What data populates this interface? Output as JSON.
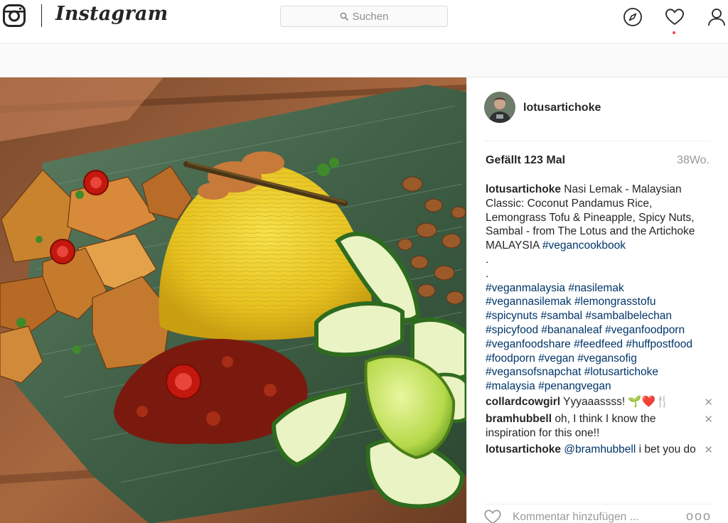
{
  "nav": {
    "logo_wordmark": "Instagram",
    "search_placeholder": "Suchen",
    "icons": [
      "instagram-glyph-icon",
      "compass-icon",
      "heart-icon",
      "profile-icon"
    ],
    "notification_dot_color": "#ed4956"
  },
  "post": {
    "author": "lotusartichoke",
    "likes": "Gefällt 123 Mal",
    "age": "38Wo.",
    "caption": {
      "username": "lotusartichoke",
      "text": "Nasi Lemak - Malaysian Classic: Coconut Pandamus Rice, Lemongrass Tofu & Pineapple, Spicy Nuts, Sambal - from The Lotus and the Artichoke MALAYSIA",
      "hashtags_line1": "#vegancookbook",
      "dots": [
        ".",
        "."
      ],
      "hashtags": "#veganmalaysia #nasilemak #vegannasilemak #lemongrasstofu #spicynuts #sambal #sambalbelechan #spicyfood #bananaleaf #veganfoodporn #veganfoodshare #feedfeed #huffpostfood #foodporn #vegan #vegansofig #vegansofsnapchat #lotusartichoke #malaysia #penangvegan"
    },
    "comments": [
      {
        "username": "collardcowgirl",
        "mention": "",
        "text": "Yyyaaassss! 🌱❤️🍴"
      },
      {
        "username": "bramhubbell",
        "mention": "",
        "text": "oh, I think I know the inspiration for this one!!"
      },
      {
        "username": "lotusartichoke",
        "mention": "@bramhubbell",
        "text": "i bet you do"
      }
    ],
    "delete_symbol": "✕",
    "comment_placeholder": "Kommentar hinzufügen ...",
    "more_label": "ooo"
  },
  "colors": {
    "link": "#003569",
    "muted": "#999999",
    "text": "#262626",
    "border": "#efefef"
  }
}
